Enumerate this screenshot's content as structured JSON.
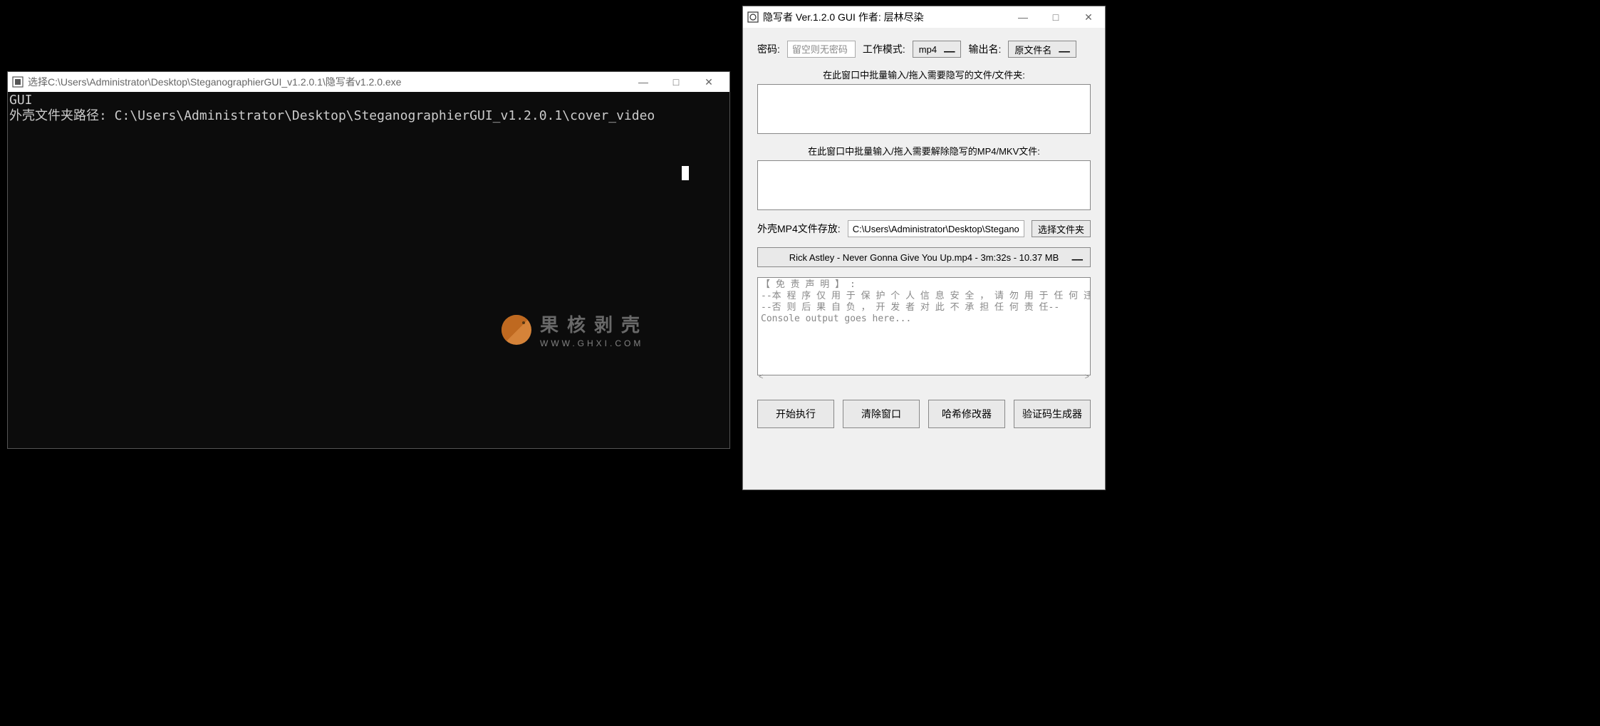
{
  "console": {
    "title": "选择C:\\Users\\Administrator\\Desktop\\SteganographierGUI_v1.2.0.1\\隐写者v1.2.0.exe",
    "line1": "GUI",
    "line2": "外壳文件夹路径: C:\\Users\\Administrator\\Desktop\\SteganographierGUI_v1.2.0.1\\cover_video"
  },
  "watermark": {
    "cn": "果核剥壳",
    "en": "WWW.GHXI.COM"
  },
  "gui": {
    "title": "隐写者 Ver.1.2.0 GUI 作者: 层林尽染",
    "password_label": "密码:",
    "password_placeholder": "留空则无密码",
    "mode_label": "工作模式:",
    "mode_value": "mp4",
    "output_label": "输出名:",
    "output_value": "原文件名",
    "hide_area_label": "在此窗口中批量输入/拖入需要隐写的文件/文件夹:",
    "reveal_area_label": "在此窗口中批量输入/拖入需要解除隐写的MP4/MKV文件:",
    "cover_label": "外壳MP4文件存放:",
    "cover_path": "C:\\Users\\Administrator\\Desktop\\Steganog",
    "browse_button": "选择文件夹",
    "cover_file": "Rick Astley - Never Gonna Give You Up.mp4 - 3m:32s - 10.37 MB",
    "log_text": "【 免 责 声 明 】 :\n--本 程 序 仅 用 于 保 护 个 人 信 息 安 全 ， 请 勿 用 于 任 何 违 法 犯 罪 活 动--\n--否 则 后 果 自 负 ， 开 发 者 对 此 不 承 担 任 何 责 任--\nConsole output goes here...",
    "buttons": {
      "start": "开始执行",
      "clear": "清除窗口",
      "hash": "哈希修改器",
      "verify": "验证码生成器"
    }
  }
}
